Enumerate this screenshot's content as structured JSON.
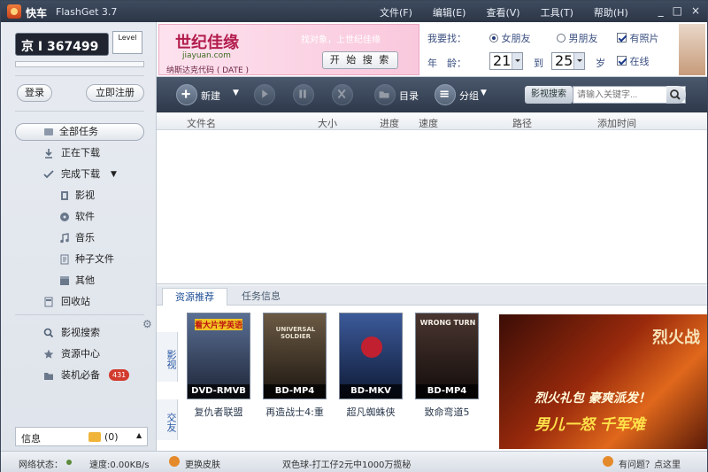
{
  "titlebar": {
    "app_name": "快车",
    "product": "FlashGet 3.7",
    "menu": [
      "文件(F)",
      "编辑(E)",
      "查看(V)",
      "工具(T)",
      "帮助(H)"
    ],
    "window_controls": [
      "_",
      "□",
      "×"
    ]
  },
  "left": {
    "user_plate": "京 I 367499",
    "level_label": "Level",
    "login_button": "登录",
    "register_button": "立即注册",
    "nav": {
      "all_tasks": "全部任务",
      "downloading": "正在下载",
      "completed": "完成下载",
      "video": "影视",
      "software": "软件",
      "music": "音乐",
      "torrent": "种子文件",
      "other": "其他",
      "recycle": "回收站",
      "movie_search": "影视搜索",
      "resource_center": "资源中心",
      "essentials": "装机必备",
      "essentials_badge": "431"
    },
    "info_label": "信息",
    "info_count": "(0)"
  },
  "banner": {
    "ad_logo": "世纪佳缘",
    "ad_url": "jiayuan.com",
    "ad_note": "纳斯达克代码 ( DATE )",
    "ad_link": "找对象，上世纪佳缘",
    "ad_button": "开 始 搜 索",
    "want_label": "我要找：",
    "female": "女朋友",
    "male": "男朋友",
    "has_photo": "有照片",
    "online": "在线",
    "age_label": "年　龄：",
    "age_from": "21",
    "to_label": "到",
    "age_to": "25",
    "age_unit": "岁"
  },
  "toolbar": {
    "new": "新建",
    "directory": "目录",
    "group": "分组",
    "movie_search_button": "影视搜索",
    "search_placeholder": "请输入关键字..."
  },
  "table": {
    "columns": [
      "文件名",
      "大小",
      "进度",
      "速度",
      "路径",
      "添加时间"
    ]
  },
  "resource": {
    "tabs": [
      "资源推荐",
      "任务信息"
    ],
    "side_video": "影视",
    "side_social": "交友",
    "movies": [
      {
        "title": "复仇者联盟",
        "format": "DVD-RMVB",
        "badge": "看大片学英语",
        "color": "#3a4d6b"
      },
      {
        "title": "再造战士4:重",
        "format": "BD-MP4",
        "badge": "UNIVERSAL SOLDIER",
        "color": "#4a3b2c"
      },
      {
        "title": "超凡蜘蛛侠",
        "format": "BD-MKV",
        "badge": "",
        "color": "#2c3f6b"
      },
      {
        "title": "致命弯道5",
        "format": "BD-MP4",
        "badge": "WRONG TURN",
        "color": "#3b2a25"
      }
    ],
    "ad_title": "烈火战",
    "ad_line1": "烈火礼包 豪爽派发！",
    "ad_line2": "男儿一怒 千军难"
  },
  "status": {
    "network": "网络状态：",
    "speed": "速度:0.00KB/s",
    "skin": "更换皮肤",
    "lottery": "双色球-打工仔2元中1000万揽秘",
    "help": "有问题？点这里"
  }
}
